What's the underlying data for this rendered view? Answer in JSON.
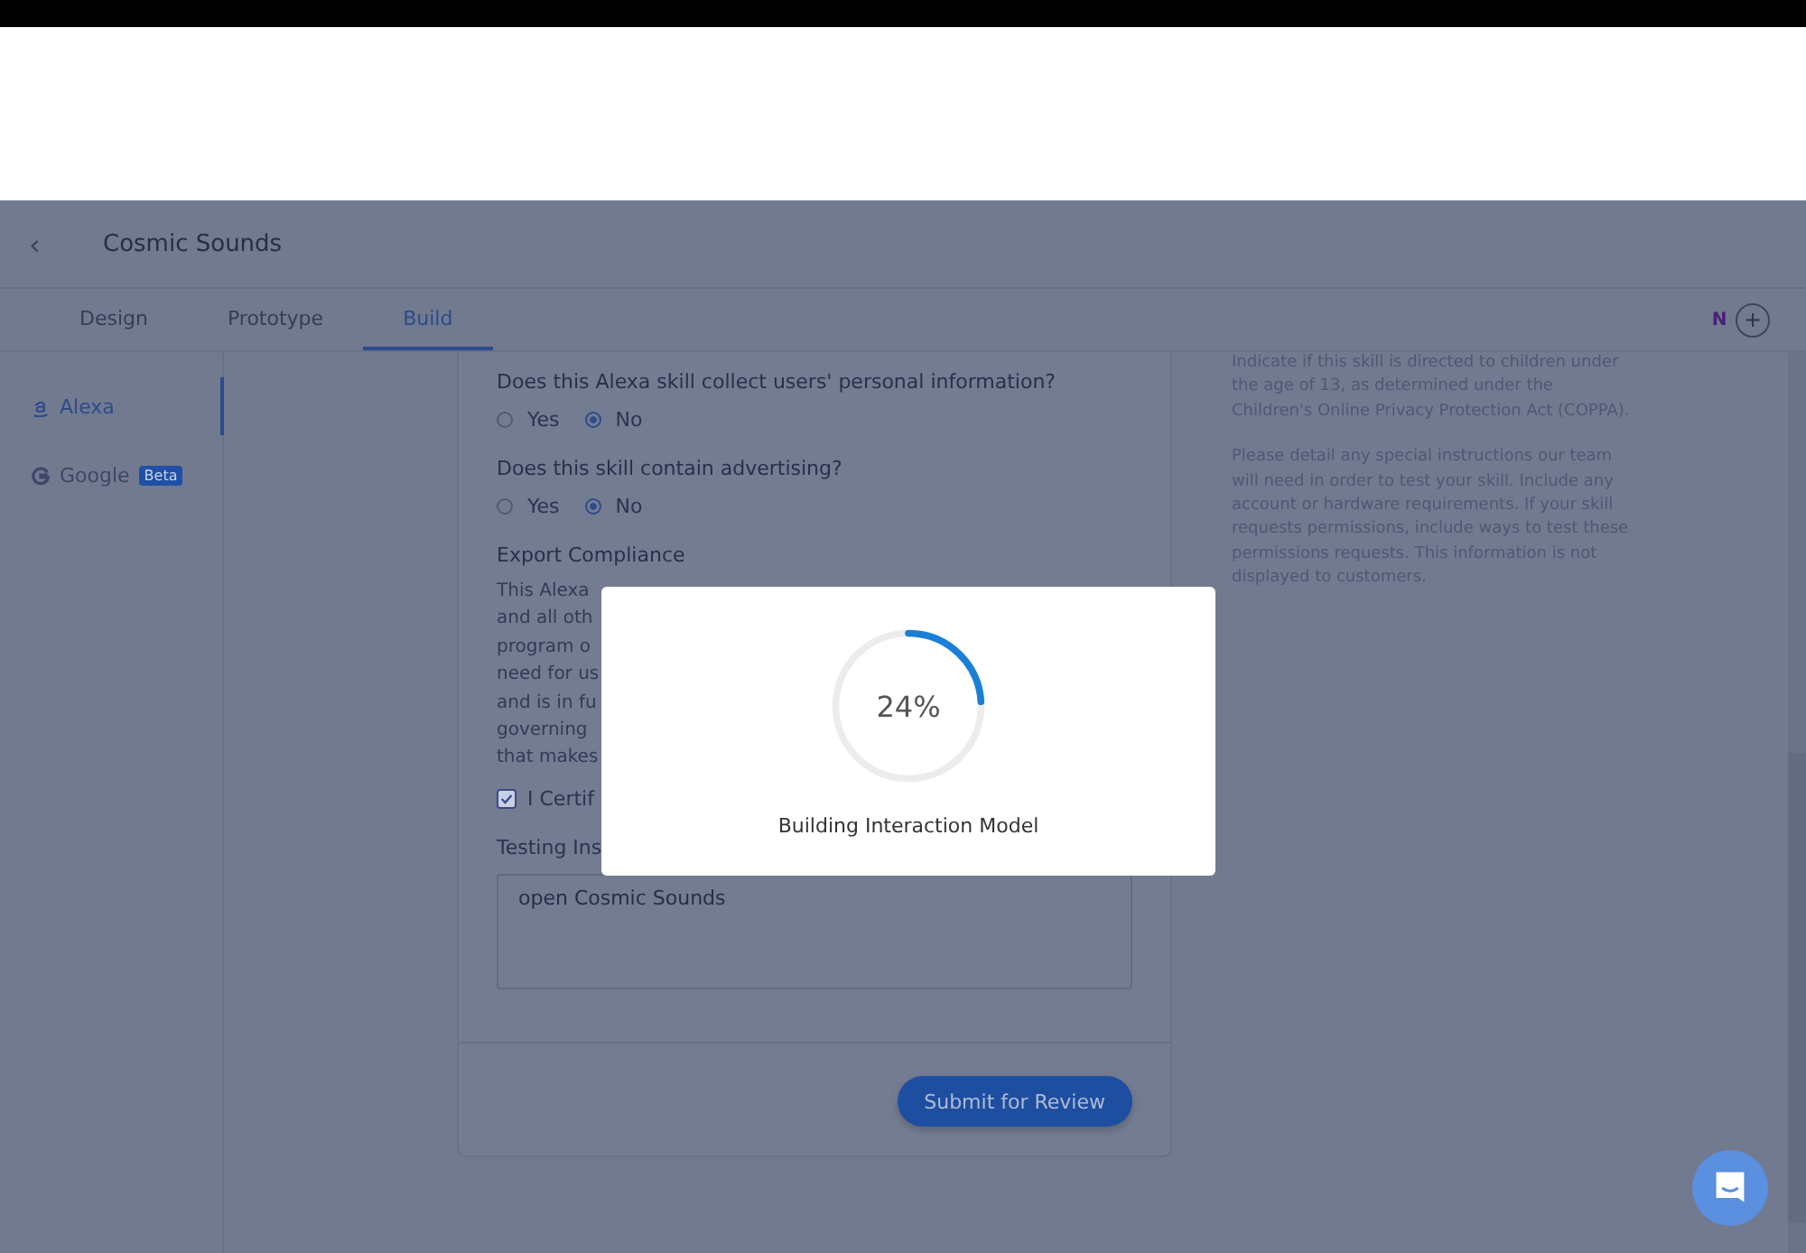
{
  "header": {
    "back_icon": "‹",
    "title": "Cosmic Sounds"
  },
  "tabs": [
    {
      "label": "Design",
      "selected": false
    },
    {
      "label": "Prototype",
      "selected": false
    },
    {
      "label": "Build",
      "selected": true
    }
  ],
  "user": {
    "initial": "N",
    "add": "+"
  },
  "sidebar": {
    "items": [
      {
        "label": "Alexa",
        "kind": "alexa",
        "selected": true
      },
      {
        "label": "Google",
        "kind": "google",
        "badge": "Beta",
        "selected": false
      }
    ]
  },
  "form": {
    "questions": [
      {
        "label": "Does this Alexa skill collect users' personal information?",
        "options": [
          {
            "label": "Yes",
            "selected": false
          },
          {
            "label": "No",
            "selected": true
          }
        ]
      },
      {
        "label": "Does this skill contain advertising?",
        "options": [
          {
            "label": "Yes",
            "selected": false
          },
          {
            "label": "No",
            "selected": true
          }
        ]
      }
    ],
    "export_heading": "Export Compliance",
    "export_lines": [
      "This Alexa",
      "and all oth",
      "program o",
      "need for us",
      "and is in fu",
      "governing",
      "that makes"
    ],
    "certify": {
      "label": "I Certif",
      "checked": true
    },
    "testing_label": "Testing Ins",
    "testing_value": "open Cosmic Sounds",
    "submit": "Submit for Review"
  },
  "help": [
    "Indicate if this skill is directed to children under the age of 13, as determined under the Children's Online Privacy Protection Act (COPPA).",
    "Please detail any special instructions our team will need in order to test your skill. Include any account or hardware requirements. If your skill requests permissions, include ways to test these permissions requests. This information is not displayed to customers."
  ],
  "modal": {
    "percent": "24%",
    "level": 0.24,
    "message": "Building Interaction Model"
  }
}
